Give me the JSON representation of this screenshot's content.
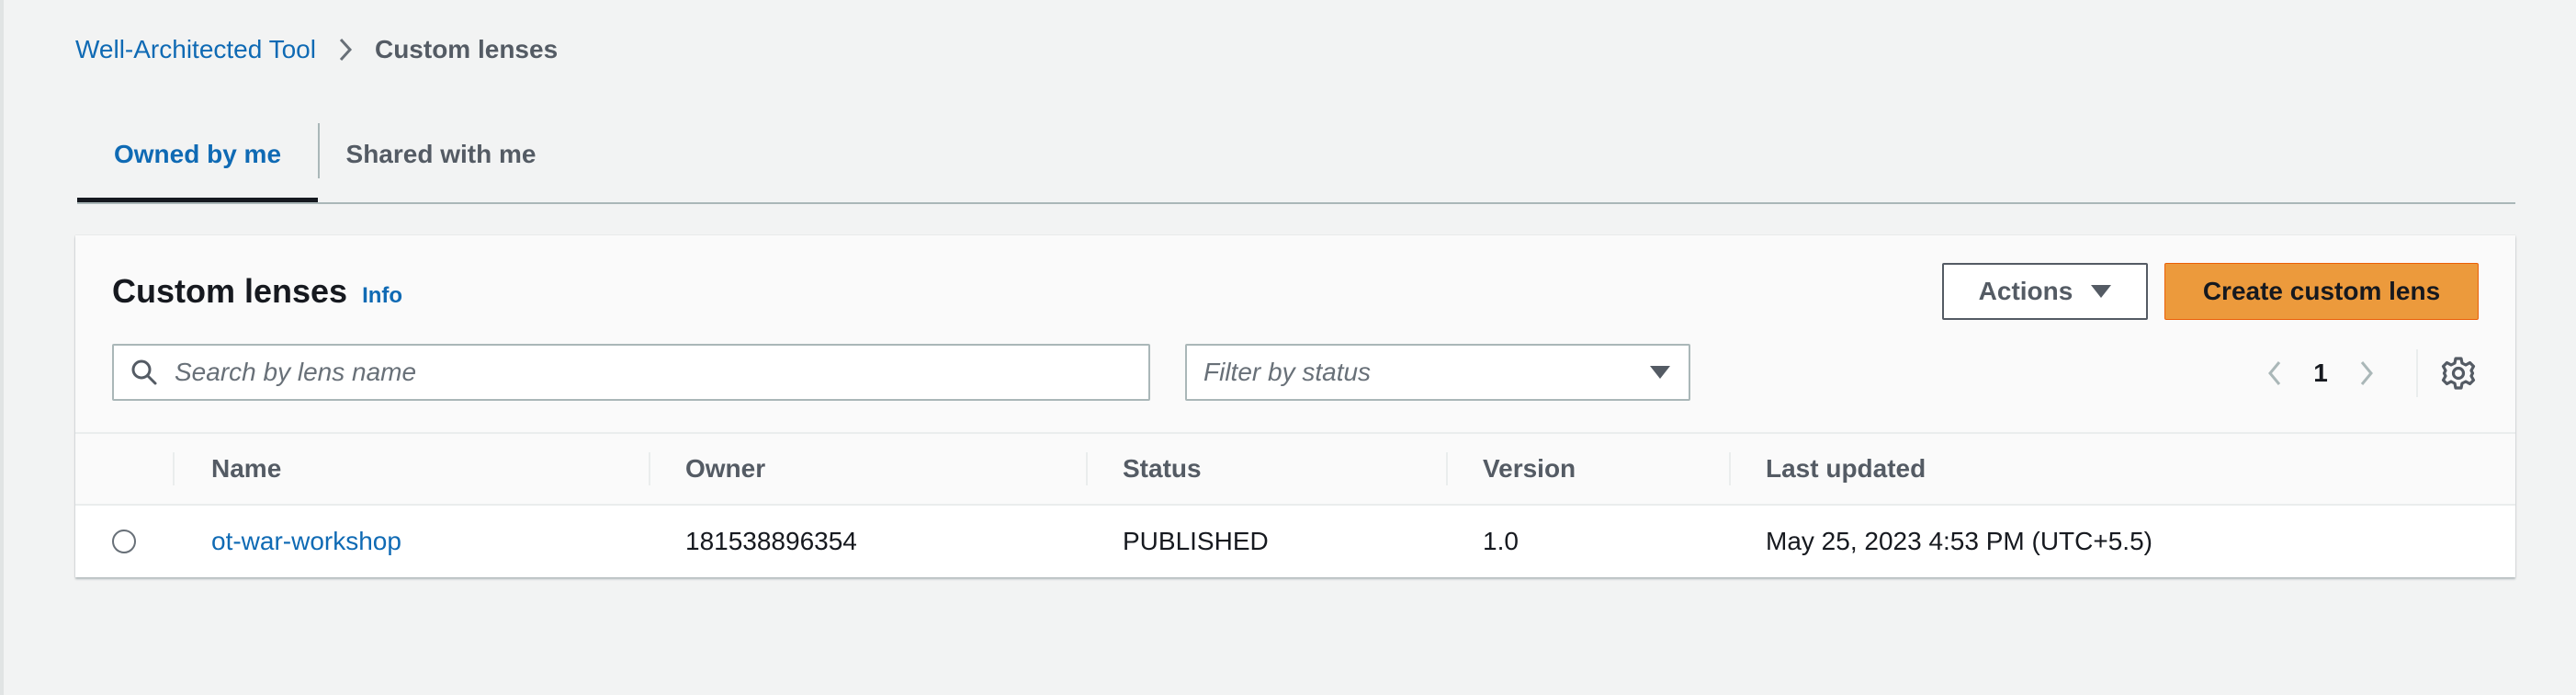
{
  "breadcrumb": {
    "root": "Well-Architected Tool",
    "current": "Custom lenses"
  },
  "tabs": [
    {
      "label": "Owned by me",
      "active": true
    },
    {
      "label": "Shared with me",
      "active": false
    }
  ],
  "panel": {
    "title": "Custom lenses",
    "info": "Info",
    "actions_label": "Actions",
    "create_label": "Create custom lens",
    "search_placeholder": "Search by lens name",
    "filter_placeholder": "Filter by status",
    "page": "1"
  },
  "table": {
    "columns": [
      "Name",
      "Owner",
      "Status",
      "Version",
      "Last updated"
    ],
    "rows": [
      {
        "name": "ot-war-workshop",
        "owner": "181538896354",
        "status": "PUBLISHED",
        "version": "1.0",
        "last_updated": "May 25, 2023 4:53 PM (UTC+5.5)",
        "selected": false
      }
    ]
  },
  "colors": {
    "link": "#0f6ab4",
    "primary_button": "#ec9a3c",
    "background": "#f2f3f3"
  },
  "icons": [
    "chevron-right-icon",
    "search-icon",
    "caret-down-icon",
    "chevron-left-icon",
    "gear-icon"
  ]
}
